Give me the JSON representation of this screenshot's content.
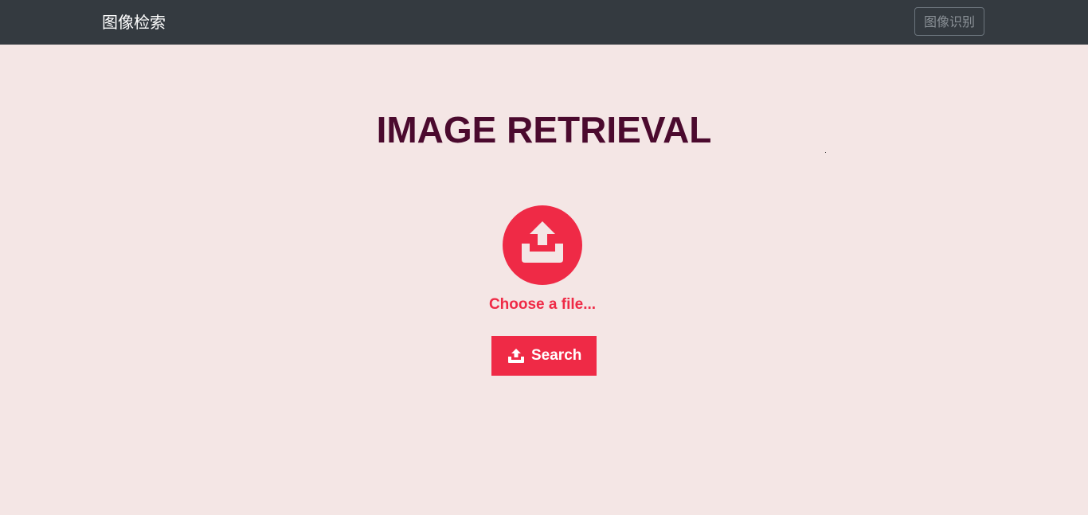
{
  "navbar": {
    "brand": "图像检索",
    "nav_button_label": "图像识别"
  },
  "main": {
    "title": "IMAGE RETRIEVAL",
    "upload": {
      "icon": "upload-tray-icon",
      "label": "Choose a file..."
    },
    "search_button": {
      "icon": "upload-icon",
      "label": "Search"
    }
  },
  "colors": {
    "navbar_bg": "#343a40",
    "page_bg": "#f4e6e5",
    "title": "#4b0a2e",
    "accent": "#ef2a46"
  }
}
